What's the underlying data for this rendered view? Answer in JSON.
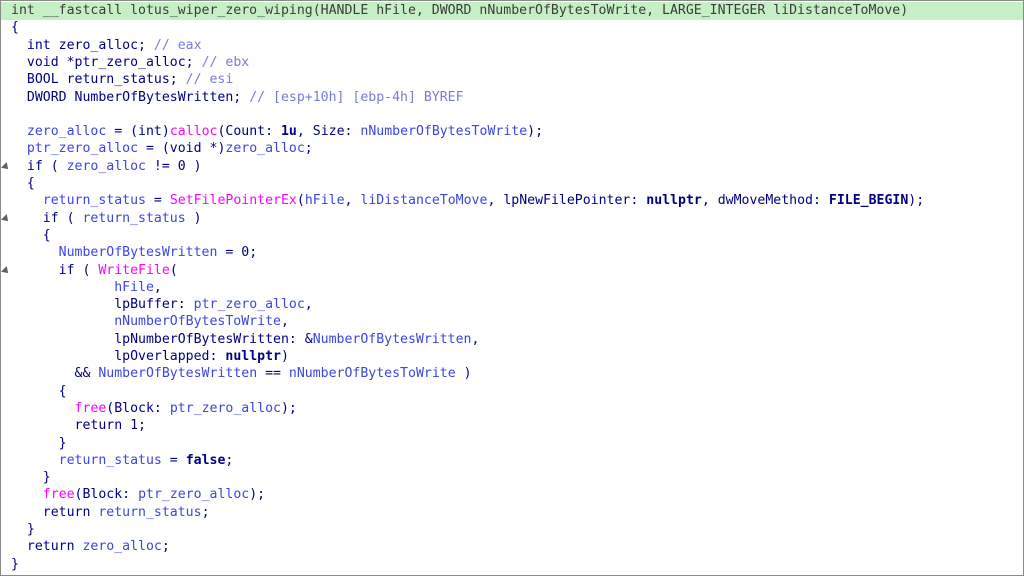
{
  "lines": [
    [
      [
        "n",
        "int __fastcall lotus_wiper_zero_wiping(HANDLE hFile, DWORD nNumberOfBytesToWrite, LARGE_INTEGER liDistanceToMove)"
      ]
    ],
    [
      [
        "t",
        "{"
      ]
    ],
    [
      [
        "t",
        "  int zero_alloc; "
      ],
      [
        "c",
        "// eax"
      ]
    ],
    [
      [
        "t",
        "  void *ptr_zero_alloc; "
      ],
      [
        "c",
        "// ebx"
      ]
    ],
    [
      [
        "t",
        "  BOOL return_status; "
      ],
      [
        "c",
        "// esi"
      ]
    ],
    [
      [
        "t",
        "  DWORD NumberOfBytesWritten; "
      ],
      [
        "c",
        "// [esp+10h] [ebp-4h] BYREF"
      ]
    ],
    [
      [
        "t",
        ""
      ]
    ],
    [
      [
        "v",
        "  zero_alloc"
      ],
      [
        "t",
        " = (int)"
      ],
      [
        "f",
        "calloc"
      ],
      [
        "t",
        "(Count: "
      ],
      [
        "k",
        "1u"
      ],
      [
        "t",
        ", Size: "
      ],
      [
        "v",
        "nNumberOfBytesToWrite"
      ],
      [
        "t",
        ");"
      ]
    ],
    [
      [
        "v",
        "  ptr_zero_alloc"
      ],
      [
        "t",
        " = (void *)"
      ],
      [
        "v",
        "zero_alloc"
      ],
      [
        "t",
        ";"
      ]
    ],
    [
      [
        "t",
        "  if ( "
      ],
      [
        "v",
        "zero_alloc"
      ],
      [
        "t",
        " != 0 )"
      ]
    ],
    [
      [
        "t",
        "  {"
      ]
    ],
    [
      [
        "v",
        "    return_status"
      ],
      [
        "t",
        " = "
      ],
      [
        "f",
        "SetFilePointerEx"
      ],
      [
        "t",
        "("
      ],
      [
        "v",
        "hFile"
      ],
      [
        "t",
        ", "
      ],
      [
        "v",
        "liDistanceToMove"
      ],
      [
        "t",
        ", lpNewFilePointer: "
      ],
      [
        "k",
        "nullptr"
      ],
      [
        "t",
        ", dwMoveMethod: "
      ],
      [
        "k",
        "FILE_BEGIN"
      ],
      [
        "t",
        ");"
      ]
    ],
    [
      [
        "t",
        "    if ( "
      ],
      [
        "v",
        "return_status"
      ],
      [
        "t",
        " )"
      ]
    ],
    [
      [
        "t",
        "    {"
      ]
    ],
    [
      [
        "v",
        "      NumberOfBytesWritten"
      ],
      [
        "t",
        " = 0;"
      ]
    ],
    [
      [
        "t",
        "      if ( "
      ],
      [
        "f",
        "WriteFile"
      ],
      [
        "t",
        "("
      ]
    ],
    [
      [
        "v",
        "             hFile"
      ],
      [
        "t",
        ","
      ]
    ],
    [
      [
        "t",
        "             lpBuffer: "
      ],
      [
        "v",
        "ptr_zero_alloc"
      ],
      [
        "t",
        ","
      ]
    ],
    [
      [
        "v",
        "             nNumberOfBytesToWrite"
      ],
      [
        "t",
        ","
      ]
    ],
    [
      [
        "t",
        "             lpNumberOfBytesWritten: &"
      ],
      [
        "v",
        "NumberOfBytesWritten"
      ],
      [
        "t",
        ","
      ]
    ],
    [
      [
        "t",
        "             lpOverlapped: "
      ],
      [
        "k",
        "nullptr"
      ],
      [
        "t",
        ")"
      ]
    ],
    [
      [
        "t",
        "        && "
      ],
      [
        "v",
        "NumberOfBytesWritten"
      ],
      [
        "t",
        " == "
      ],
      [
        "v",
        "nNumberOfBytesToWrite"
      ],
      [
        "t",
        " )"
      ]
    ],
    [
      [
        "t",
        "      {"
      ]
    ],
    [
      [
        "f",
        "        free"
      ],
      [
        "t",
        "(Block: "
      ],
      [
        "v",
        "ptr_zero_alloc"
      ],
      [
        "t",
        ");"
      ]
    ],
    [
      [
        "t",
        "        return 1;"
      ]
    ],
    [
      [
        "t",
        "      }"
      ]
    ],
    [
      [
        "v",
        "      return_status"
      ],
      [
        "t",
        " = "
      ],
      [
        "k",
        "false"
      ],
      [
        "t",
        ";"
      ]
    ],
    [
      [
        "t",
        "    }"
      ]
    ],
    [
      [
        "f",
        "    free"
      ],
      [
        "t",
        "(Block: "
      ],
      [
        "v",
        "ptr_zero_alloc"
      ],
      [
        "t",
        ");"
      ]
    ],
    [
      [
        "t",
        "    return "
      ],
      [
        "v",
        "return_status"
      ],
      [
        "t",
        ";"
      ]
    ],
    [
      [
        "t",
        "  }"
      ]
    ],
    [
      [
        "t",
        "  return "
      ],
      [
        "v",
        "zero_alloc"
      ],
      [
        "t",
        ";"
      ]
    ],
    [
      [
        "t",
        "}"
      ]
    ]
  ],
  "highlighted_line": 0,
  "marker_lines": [
    9,
    12,
    15
  ]
}
